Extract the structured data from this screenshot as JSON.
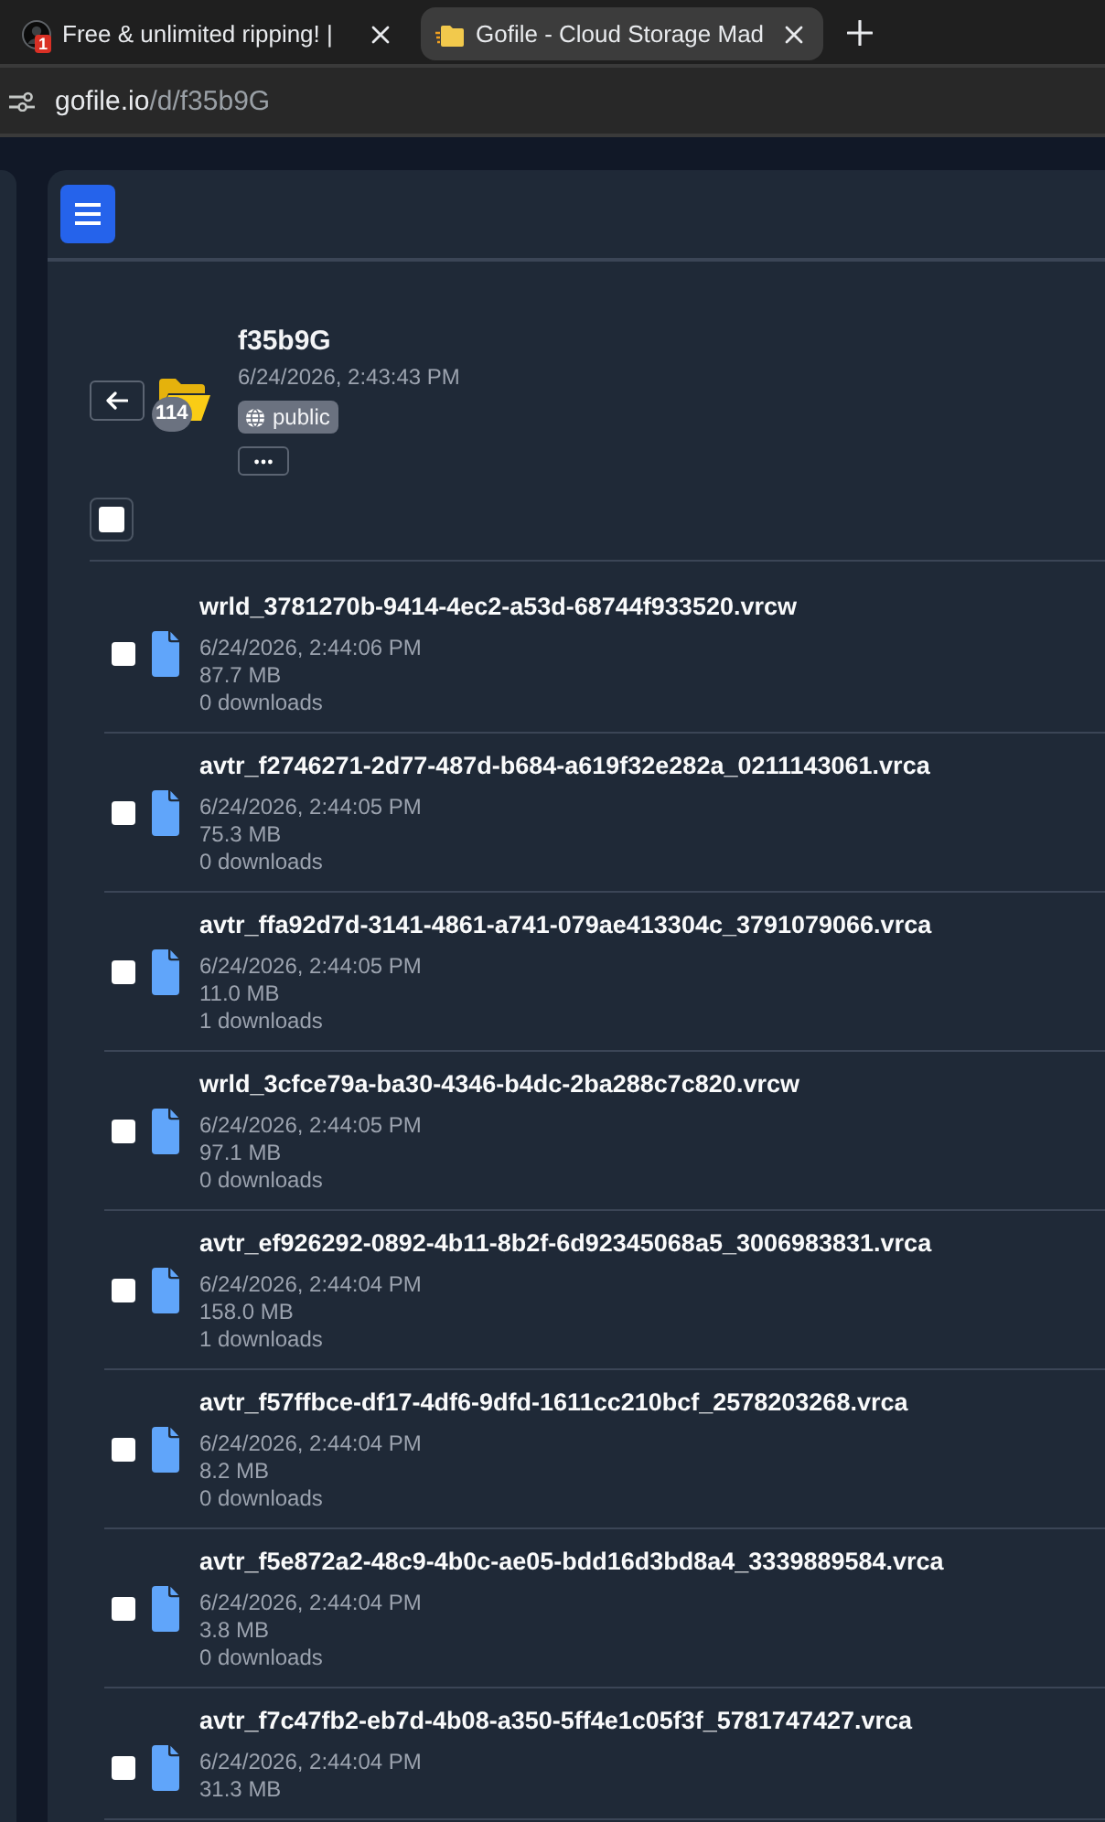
{
  "browser": {
    "tabs": [
      {
        "kind": "avatar",
        "title": "Free & unlimited ripping! |",
        "badge": "1",
        "selected": false
      },
      {
        "kind": "folder",
        "title": "Gofile - Cloud Storage Mad",
        "selected": true
      }
    ],
    "address": {
      "host": "gofile.io",
      "path": "/d/f35b9G"
    }
  },
  "folder": {
    "name": "f35b9G",
    "created": "6/24/2026, 2:43:43 PM",
    "visibility": "public",
    "item_count": "114",
    "select_all_checked": false
  },
  "files": [
    {
      "name": "wrld_3781270b-9414-4ec2-a53d-68744f933520.vrcw",
      "date": "6/24/2026, 2:44:06 PM",
      "size": "87.7 MB",
      "downloads": "0 downloads",
      "checked": false
    },
    {
      "name": "avtr_f2746271-2d77-487d-b684-a619f32e282a_0211143061.vrca",
      "date": "6/24/2026, 2:44:05 PM",
      "size": "75.3 MB",
      "downloads": "0 downloads",
      "checked": false
    },
    {
      "name": "avtr_ffa92d7d-3141-4861-a741-079ae413304c_3791079066.vrca",
      "date": "6/24/2026, 2:44:05 PM",
      "size": "11.0 MB",
      "downloads": "1 downloads",
      "checked": false
    },
    {
      "name": "wrld_3cfce79a-ba30-4346-b4dc-2ba288c7c820.vrcw",
      "date": "6/24/2026, 2:44:05 PM",
      "size": "97.1 MB",
      "downloads": "0 downloads",
      "checked": false
    },
    {
      "name": "avtr_ef926292-0892-4b11-8b2f-6d92345068a5_3006983831.vrca",
      "date": "6/24/2026, 2:44:04 PM",
      "size": "158.0 MB",
      "downloads": "1 downloads",
      "checked": false
    },
    {
      "name": "avtr_f57ffbce-df17-4df6-9dfd-1611cc210bcf_2578203268.vrca",
      "date": "6/24/2026, 2:44:04 PM",
      "size": "8.2 MB",
      "downloads": "0 downloads",
      "checked": false
    },
    {
      "name": "avtr_f5e872a2-48c9-4b0c-ae05-bdd16d3bd8a4_3339889584.vrca",
      "date": "6/24/2026, 2:44:04 PM",
      "size": "3.8 MB",
      "downloads": "0 downloads",
      "checked": false
    },
    {
      "name": "avtr_f7c47fb2-eb7d-4b08-a350-5ff4e1c05f3f_5781747427.vrca",
      "date": "6/24/2026, 2:44:04 PM",
      "size": "31.3 MB",
      "checked": false
    }
  ]
}
